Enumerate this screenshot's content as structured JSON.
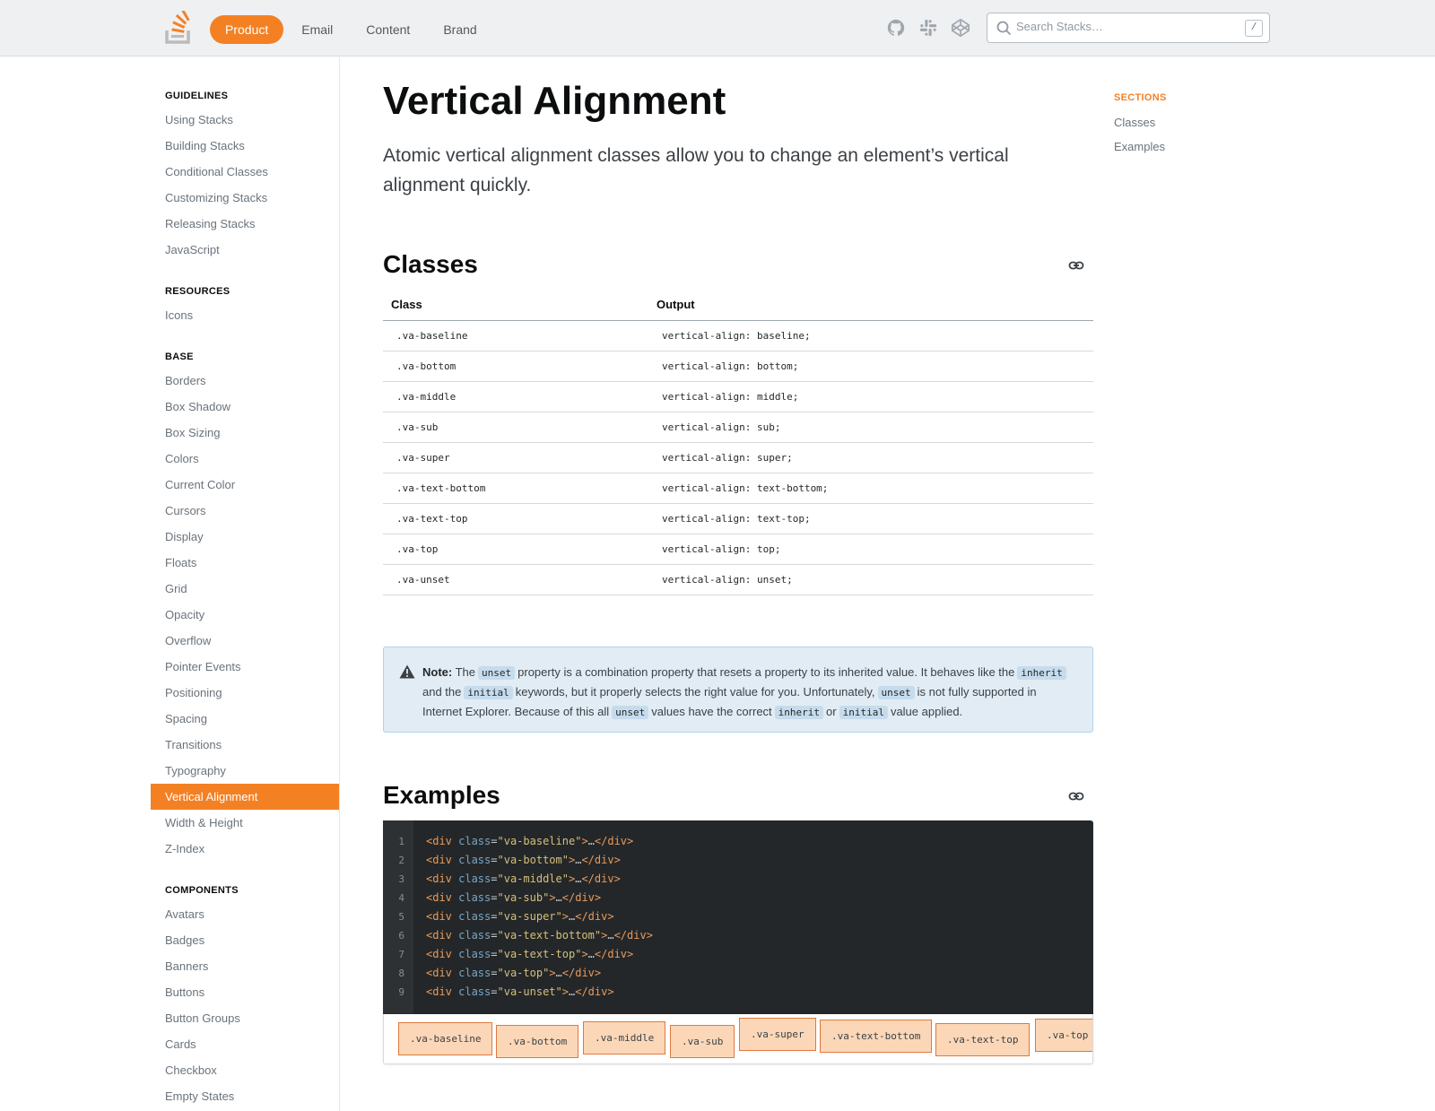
{
  "header": {
    "nav": [
      "Product",
      "Email",
      "Content",
      "Brand"
    ],
    "search_placeholder": "Search Stacks…",
    "search_shortcut": "/",
    "icons": [
      "github-icon",
      "slack-icon",
      "codepen-icon"
    ]
  },
  "sidebar": {
    "guidelines": {
      "heading": "GUIDELINES",
      "items": [
        "Using Stacks",
        "Building Stacks",
        "Conditional Classes",
        "Customizing Stacks",
        "Releasing Stacks",
        "JavaScript"
      ]
    },
    "resources": {
      "heading": "RESOURCES",
      "items": [
        "Icons"
      ]
    },
    "base": {
      "heading": "BASE",
      "items": [
        "Borders",
        "Box Shadow",
        "Box Sizing",
        "Colors",
        "Current Color",
        "Cursors",
        "Display",
        "Floats",
        "Grid",
        "Opacity",
        "Overflow",
        "Pointer Events",
        "Positioning",
        "Spacing",
        "Transitions",
        "Typography",
        "Vertical Alignment",
        "Width & Height",
        "Z-Index"
      ]
    },
    "components": {
      "heading": "COMPONENTS",
      "items": [
        "Avatars",
        "Badges",
        "Banners",
        "Buttons",
        "Button Groups",
        "Cards",
        "Checkbox",
        "Empty States"
      ]
    },
    "active_item": "Vertical Alignment"
  },
  "main": {
    "title": "Vertical Alignment",
    "lead": "Atomic vertical alignment classes allow you to change an element’s vertical alignment quickly.",
    "classes_heading": "Classes",
    "table": {
      "headers": [
        "Class",
        "Output"
      ],
      "rows": [
        [
          ".va-baseline",
          "vertical-align: baseline;"
        ],
        [
          ".va-bottom",
          "vertical-align: bottom;"
        ],
        [
          ".va-middle",
          "vertical-align: middle;"
        ],
        [
          ".va-sub",
          "vertical-align: sub;"
        ],
        [
          ".va-super",
          "vertical-align: super;"
        ],
        [
          ".va-text-bottom",
          "vertical-align: text-bottom;"
        ],
        [
          ".va-text-top",
          "vertical-align: text-top;"
        ],
        [
          ".va-top",
          "vertical-align: top;"
        ],
        [
          ".va-unset",
          "vertical-align: unset;"
        ]
      ]
    },
    "note": {
      "label": "Note:",
      "t1": "The",
      "c1": "unset",
      "t2": "property is a combination property that resets a property to its inherited value. It behaves like the",
      "c2": "inherit",
      "t3": "and the",
      "c3": "initial",
      "t4": "keywords, but it properly selects the right value for you. Unfortunately,",
      "c4": "unset",
      "t5": "is not fully supported in Internet Explorer. Because of this all",
      "c5": "unset",
      "t6": "values have the correct",
      "c6": "inherit",
      "t7": "or",
      "c7": "initial",
      "t8": "value applied."
    },
    "examples_heading": "Examples",
    "code_classes": [
      "va-baseline",
      "va-bottom",
      "va-middle",
      "va-sub",
      "va-super",
      "va-text-bottom",
      "va-text-top",
      "va-top",
      "va-unset"
    ],
    "demo_chips": [
      ".va-baseline",
      ".va-bottom",
      ".va-middle",
      ".va-sub",
      ".va-super",
      ".va-text-bottom",
      ".va-text-top",
      ".va-top"
    ]
  },
  "toc": {
    "heading": "SECTIONS",
    "items": [
      "Classes",
      "Examples"
    ]
  },
  "colors": {
    "accent": "#f48024",
    "note_bg": "#e1ecf4",
    "code_bg": "#242729"
  }
}
